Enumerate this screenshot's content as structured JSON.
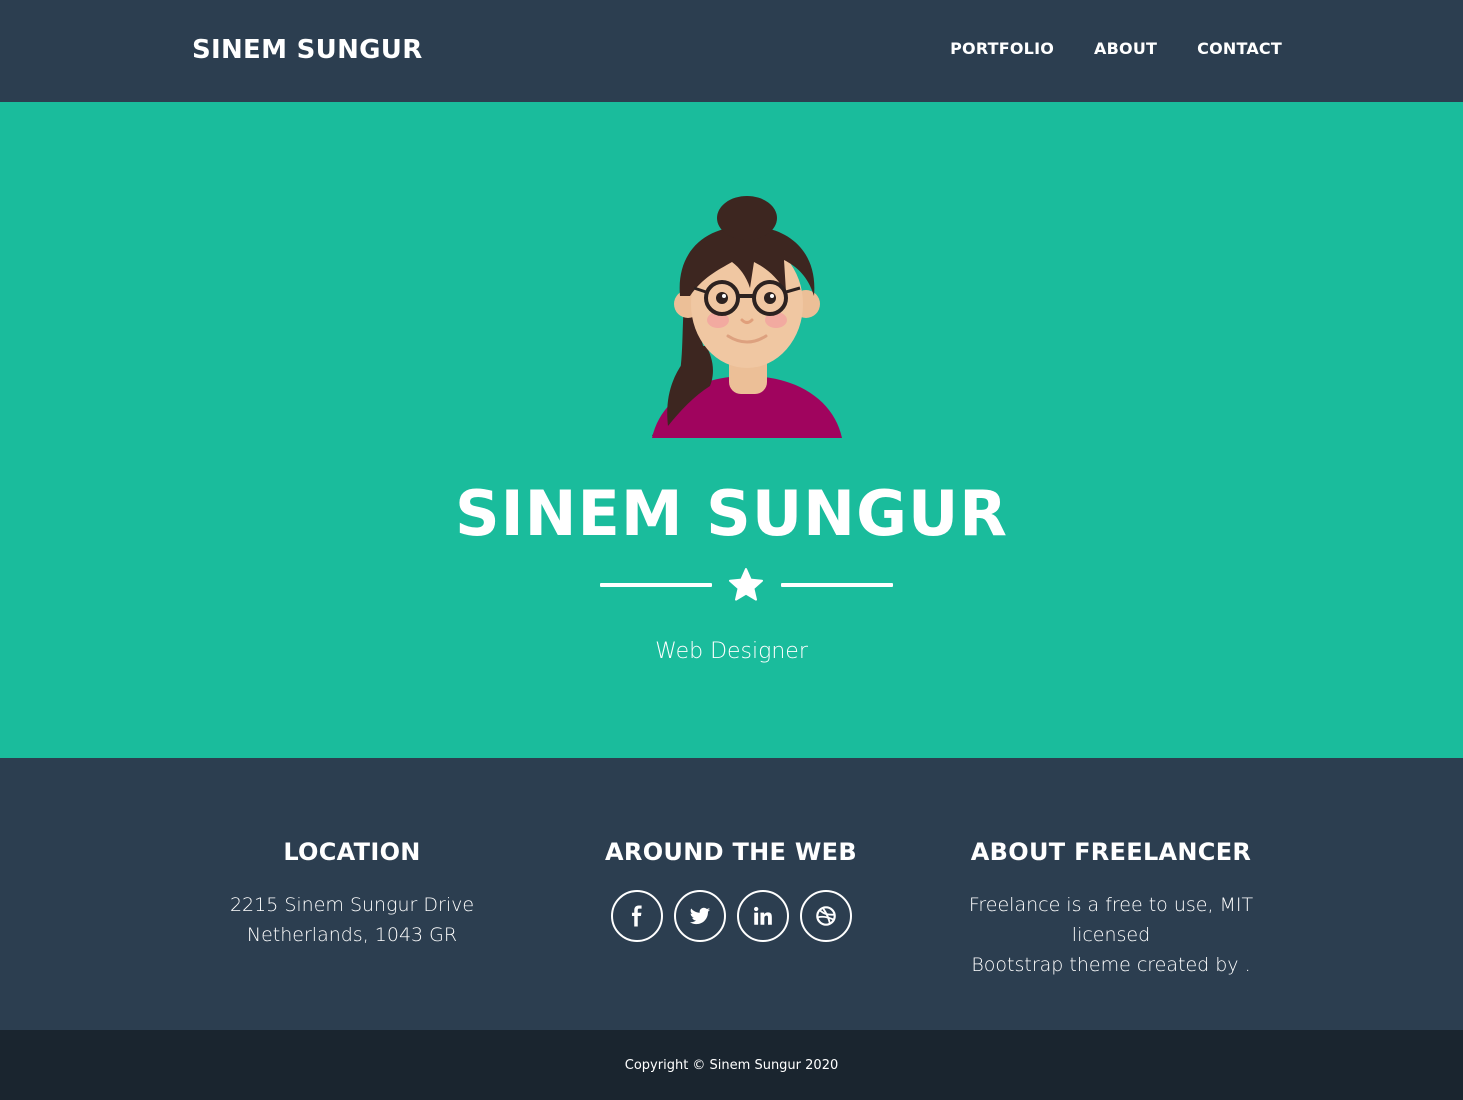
{
  "navbar": {
    "brand": "SINEM SUNGUR",
    "links": [
      {
        "label": "PORTFOLIO"
      },
      {
        "label": "ABOUT"
      },
      {
        "label": "CONTACT"
      }
    ]
  },
  "masthead": {
    "avatar_icon": "female-avatar-icon",
    "title": "SINEM SUNGUR",
    "divider_icon": "star-icon",
    "subtitle": "Web Designer"
  },
  "footer": {
    "location": {
      "heading": "LOCATION",
      "line1": "2215 Sinem Sungur Drive",
      "line2": "Netherlands, 1043 GR"
    },
    "web": {
      "heading": "AROUND THE WEB",
      "icons": [
        "facebook-icon",
        "twitter-icon",
        "linkedin-icon",
        "dribbble-icon"
      ]
    },
    "about": {
      "heading": "ABOUT FREELANCER",
      "line1": "Freelance is a free to use, MIT licensed",
      "line2": "Bootstrap theme created by ."
    }
  },
  "copyright": {
    "text": "Copyright © Sinem Sungur 2020"
  },
  "colors": {
    "primary": "#1abc9c",
    "secondary": "#2c3e50",
    "dark": "#1a252f",
    "text": "#ffffff"
  }
}
